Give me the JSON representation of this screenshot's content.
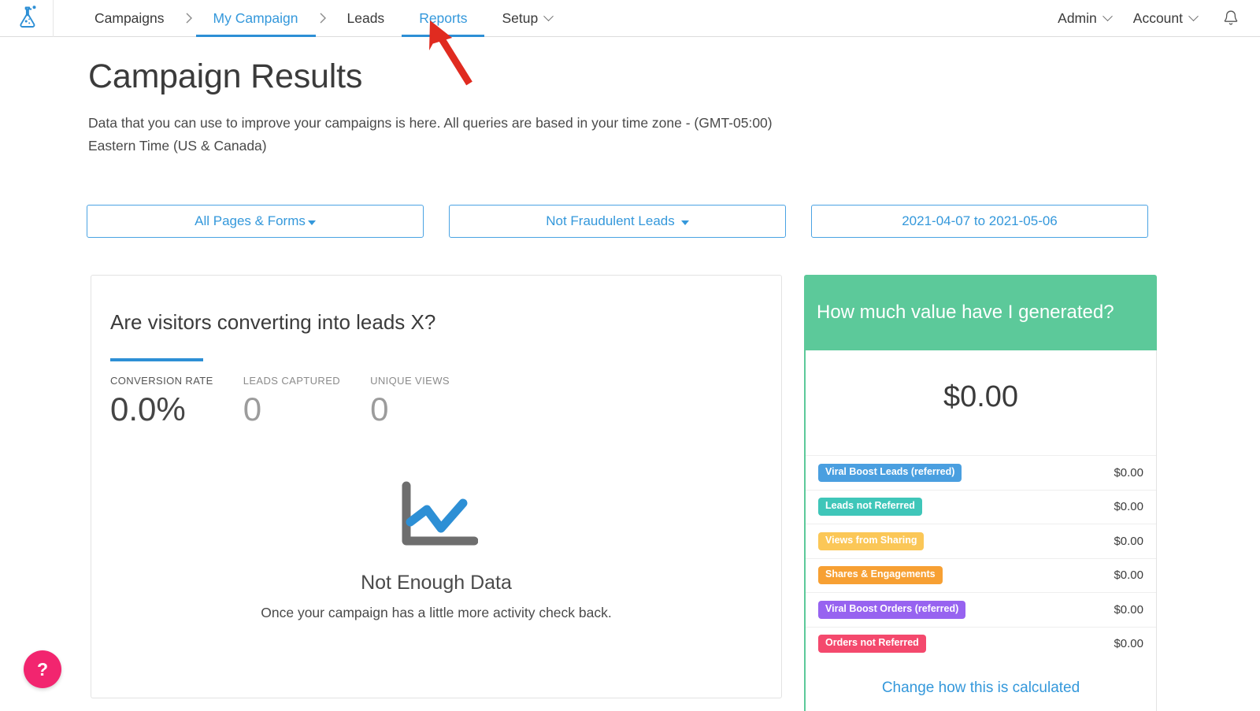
{
  "brand": {
    "logo_icon": "beaker-flask-icon",
    "accent_blue": "#3498db",
    "accent_green": "#5cc99a",
    "accent_pink": "#f2256f"
  },
  "topnav": {
    "breadcrumb": [
      {
        "label": "Campaigns",
        "state": "normal"
      },
      {
        "label": "My Campaign",
        "state": "active"
      },
      {
        "label": "Leads",
        "state": "normal"
      },
      {
        "label": "Reports",
        "state": "link-underlined"
      },
      {
        "label": "Setup",
        "state": "dropdown"
      }
    ],
    "separator": "›",
    "right": [
      {
        "label": "Admin",
        "caret": true
      },
      {
        "label": "Account",
        "caret": true
      }
    ],
    "bell_icon": "notification-bell-icon"
  },
  "header": {
    "title": "Campaign Results",
    "description": "Data that you can use to improve your campaigns is here. All queries are based in your time zone - (GMT-05:00) Eastern Time (US & Canada)"
  },
  "filters": [
    {
      "label": "All Pages & Forms",
      "caret": true,
      "caret_spaced": false
    },
    {
      "label": "Not Fraudulent Leads",
      "caret": true,
      "caret_spaced": true
    },
    {
      "label": "2021-04-07 to 2021-05-06",
      "caret": false,
      "caret_spaced": false
    }
  ],
  "left_card": {
    "title": "Are visitors converting into leads X?",
    "metrics": [
      {
        "label": "CONVERSION RATE",
        "value": "0.0%"
      },
      {
        "label": "LEADS CAPTURED",
        "value": "0"
      },
      {
        "label": "UNIQUE VIEWS",
        "value": "0"
      }
    ],
    "empty_state": {
      "icon": "line-chart-icon",
      "title": "Not Enough Data",
      "subtitle": "Once your campaign has a little more activity check back."
    }
  },
  "right_card": {
    "title": "How much value have I generated?",
    "total": "$0.00",
    "rows": [
      {
        "label": "Viral Boost Leads (referred)",
        "amount": "$0.00",
        "color": "#4a9fe0"
      },
      {
        "label": "Leads not Referred",
        "amount": "$0.00",
        "color": "#3fc6b9"
      },
      {
        "label": "Views from Sharing",
        "amount": "$0.00",
        "color": "#fbc757"
      },
      {
        "label": "Shares & Engagements",
        "amount": "$0.00",
        "color": "#f7a033"
      },
      {
        "label": "Viral Boost Orders (referred)",
        "amount": "$0.00",
        "color": "#9763f0"
      },
      {
        "label": "Orders not Referred",
        "amount": "$0.00",
        "color": "#f4496d"
      }
    ],
    "calc_link": "Change how this is calculated"
  },
  "help": {
    "label": "?",
    "icon": "question-mark-icon"
  },
  "annotation": {
    "arrow_icon": "red-arrow-pointing-to-reports",
    "color": "#e02b20"
  }
}
